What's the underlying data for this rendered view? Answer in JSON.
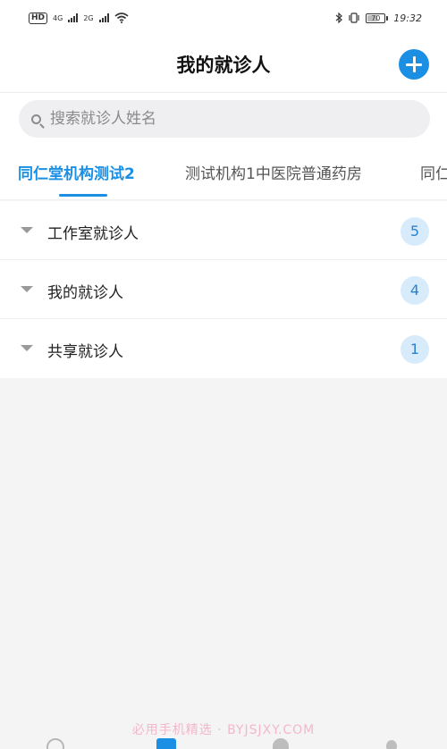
{
  "status_bar": {
    "hd_label": "HD",
    "network_1": "4G",
    "network_2": "2G",
    "battery_level": "70",
    "time": "19:32",
    "icons": [
      "hd-icon",
      "signal-icon",
      "wifi-icon",
      "bluetooth-icon",
      "vibrate-icon",
      "battery-icon"
    ]
  },
  "header": {
    "title": "我的就诊人",
    "add_icon": "plus-circle-icon",
    "accent_color": "#1a8fe3"
  },
  "search": {
    "placeholder": "搜索就诊人姓名",
    "value": "",
    "icon": "search-icon"
  },
  "tabs": [
    {
      "label": "同仁堂机构测试2",
      "active": true
    },
    {
      "label": "测试机构1中医院普通药房",
      "active": false
    },
    {
      "label": "同仁",
      "active": false
    }
  ],
  "groups": [
    {
      "label": "工作室就诊人",
      "count": "5"
    },
    {
      "label": "我的就诊人",
      "count": "4"
    },
    {
      "label": "共享就诊人",
      "count": "1"
    }
  ],
  "watermark": "必用手机精选 · BYJSJXY.COM",
  "bottom_nav": {
    "icons": [
      "home-icon",
      "calendar-icon",
      "patients-icon",
      "profile-icon"
    ],
    "active_index": 1
  }
}
